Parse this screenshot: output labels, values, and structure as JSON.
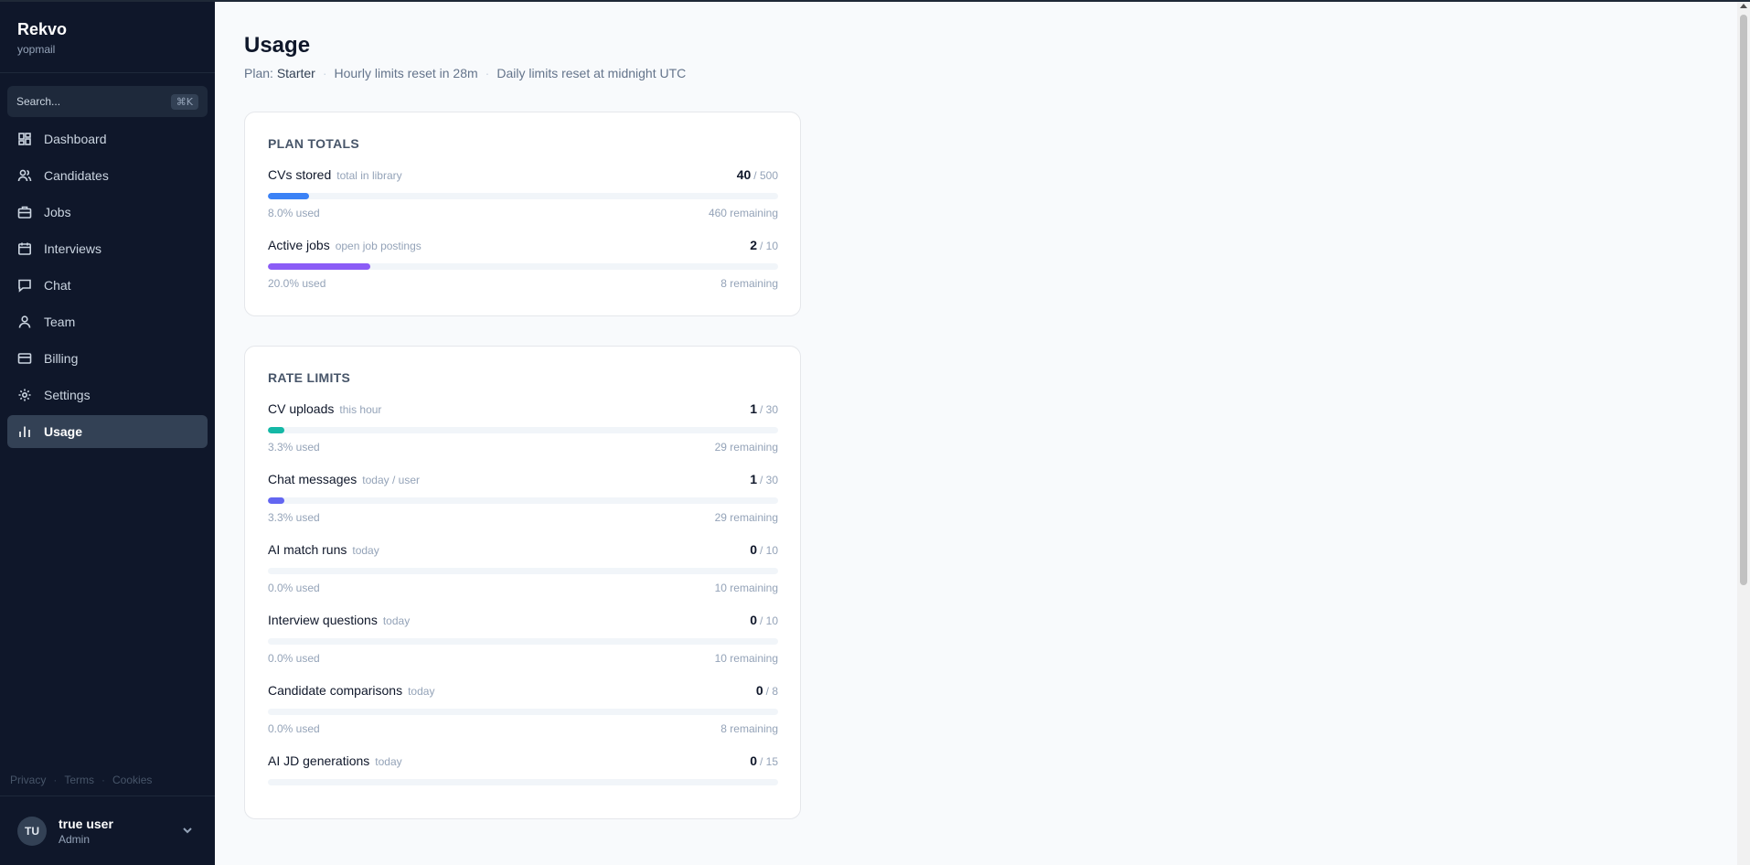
{
  "app": {
    "name": "Rekvo",
    "org": "yopmail"
  },
  "search": {
    "placeholder": "Search...",
    "shortcut": "⌘K"
  },
  "nav": [
    {
      "label": "Dashboard",
      "icon": "dashboard-icon"
    },
    {
      "label": "Candidates",
      "icon": "users-icon"
    },
    {
      "label": "Jobs",
      "icon": "briefcase-icon"
    },
    {
      "label": "Interviews",
      "icon": "calendar-icon"
    },
    {
      "label": "Chat",
      "icon": "chat-icon"
    },
    {
      "label": "Team",
      "icon": "team-icon"
    },
    {
      "label": "Billing",
      "icon": "credit-card-icon"
    },
    {
      "label": "Settings",
      "icon": "gear-icon"
    },
    {
      "label": "Usage",
      "icon": "bar-chart-icon",
      "active": true
    }
  ],
  "footer": {
    "links": [
      "Privacy",
      "Terms",
      "Cookies"
    ]
  },
  "user": {
    "initials": "TU",
    "name": "true user",
    "role": "Admin"
  },
  "page": {
    "title": "Usage",
    "plan_label": "Plan:",
    "plan_name": "Starter",
    "hourly_reset": "Hourly limits reset in 28m",
    "daily_reset": "Daily limits reset at midnight UTC"
  },
  "plan_totals": {
    "title": "PLAN TOTALS",
    "meters": [
      {
        "label": "CVs stored",
        "hint": "total in library",
        "used": "40",
        "limit": "/ 500",
        "pct_text": "8.0% used",
        "remaining": "460 remaining",
        "fraction": 0.08,
        "color": "#3b82f6"
      },
      {
        "label": "Active jobs",
        "hint": "open job postings",
        "used": "2",
        "limit": "/ 10",
        "pct_text": "20.0% used",
        "remaining": "8 remaining",
        "fraction": 0.2,
        "color": "#8b5cf6"
      }
    ]
  },
  "rate_limits": {
    "title": "RATE LIMITS",
    "meters": [
      {
        "label": "CV uploads",
        "hint": "this hour",
        "used": "1",
        "limit": "/ 30",
        "pct_text": "3.3% used",
        "remaining": "29 remaining",
        "fraction": 0.033,
        "color": "#14b8a6"
      },
      {
        "label": "Chat messages",
        "hint": "today / user",
        "used": "1",
        "limit": "/ 30",
        "pct_text": "3.3% used",
        "remaining": "29 remaining",
        "fraction": 0.033,
        "color": "#6366f1"
      },
      {
        "label": "AI match runs",
        "hint": "today",
        "used": "0",
        "limit": "/ 10",
        "pct_text": "0.0% used",
        "remaining": "10 remaining",
        "fraction": 0.0,
        "color": "#3b82f6"
      },
      {
        "label": "Interview questions",
        "hint": "today",
        "used": "0",
        "limit": "/ 10",
        "pct_text": "0.0% used",
        "remaining": "10 remaining",
        "fraction": 0.0,
        "color": "#3b82f6"
      },
      {
        "label": "Candidate comparisons",
        "hint": "today",
        "used": "0",
        "limit": "/ 8",
        "pct_text": "0.0% used",
        "remaining": "8 remaining",
        "fraction": 0.0,
        "color": "#3b82f6"
      },
      {
        "label": "AI JD generations",
        "hint": "today",
        "used": "0",
        "limit": "/ 15",
        "pct_text": "",
        "remaining": "",
        "fraction": 0.0,
        "color": "#3b82f6"
      }
    ]
  }
}
